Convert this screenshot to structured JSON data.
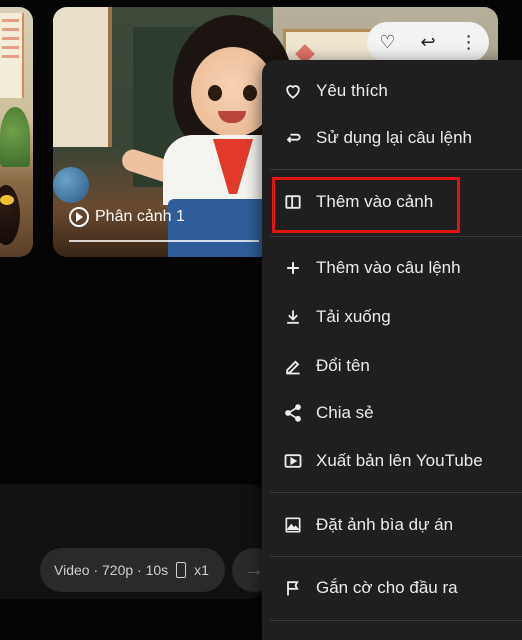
{
  "scene": {
    "label": "Phân cảnh 1"
  },
  "top_actions": [
    {
      "name": "favorite-icon",
      "glyph": "♡"
    },
    {
      "name": "reuse-icon",
      "glyph": "↩"
    },
    {
      "name": "more-vert-icon",
      "glyph": "⋮"
    }
  ],
  "prompt": {
    "chip_text": "Video · 720p · 10s",
    "count": "x1",
    "send_glyph": "→"
  },
  "menu": {
    "items": [
      {
        "label": "Yêu thích",
        "icon": "heart-icon"
      },
      {
        "label": "Sử dụng lại câu lệnh",
        "icon": "reuse-icon"
      },
      {
        "label": "Thêm vào cảnh",
        "icon": "add-to-scene-icon"
      },
      {
        "label": "Thêm vào câu lệnh",
        "icon": "plus-icon"
      },
      {
        "label": "Tải xuống",
        "icon": "download-icon"
      },
      {
        "label": "Đổi tên",
        "icon": "pencil-icon"
      },
      {
        "label": "Chia sẻ",
        "icon": "share-icon"
      },
      {
        "label": "Xuất bản lên YouTube",
        "icon": "youtube-icon"
      },
      {
        "label": "Đặt ảnh bìa dự án",
        "icon": "image-icon"
      },
      {
        "label": "Gắn cờ cho đầu ra",
        "icon": "flag-icon"
      }
    ],
    "highlight_color": "#e21515"
  }
}
